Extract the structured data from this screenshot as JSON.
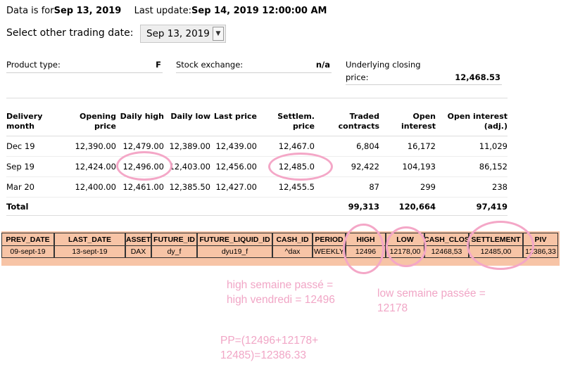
{
  "header": {
    "data_is_for_label": "Data is for",
    "data_date": "Sep 13, 2019",
    "last_update_label": "Last update:",
    "last_update_value": "Sep 14, 2019 12:00:00 AM"
  },
  "date_select": {
    "label": "Select other trading date:",
    "value": "Sep 13, 2019"
  },
  "info": {
    "product_type_label": "Product type:",
    "product_type_value": "F",
    "stock_exchange_label": "Stock exchange:",
    "stock_exchange_value": "n/a",
    "underlying_label_1": "Underlying closing",
    "underlying_label_2": "price:",
    "underlying_value": "12,468.53"
  },
  "table": {
    "headers": [
      [
        "Delivery",
        "month"
      ],
      [
        "Opening",
        "price"
      ],
      [
        "Daily high",
        ""
      ],
      [
        "Daily low",
        ""
      ],
      [
        "Last price",
        ""
      ],
      [
        "Settlem.",
        "price"
      ],
      [
        "Traded",
        "contracts"
      ],
      [
        "Open",
        "interest"
      ],
      [
        "Open interest",
        "(adj.)"
      ]
    ],
    "rows": [
      [
        "Dec 19",
        "12,390.00",
        "12,479.00",
        "12,389.00",
        "12,439.00",
        "12,467.0",
        "6,804",
        "16,172",
        "11,029"
      ],
      [
        "Sep 19",
        "12,424.00",
        "12,496.00",
        "12,403.00",
        "12,456.00",
        "12,485.0",
        "92,422",
        "104,193",
        "86,152"
      ],
      [
        "Mar 20",
        "12,400.00",
        "12,461.00",
        "12,385.50",
        "12,427.00",
        "12,455.5",
        "87",
        "299",
        "238"
      ]
    ],
    "total": {
      "label": "Total",
      "traded": "99,313",
      "open_interest": "120,664",
      "open_interest_adj": "97,419"
    }
  },
  "orange_table": {
    "headers": [
      "PREV_DATE",
      "LAST_DATE",
      "ASSET",
      "FUTURE_ID",
      "FUTURE_LIQUID_ID",
      "CASH_ID",
      "PERIOD",
      "HIGH",
      "LOW",
      "CASH_CLOS",
      "SETTLEMENT",
      "PIV"
    ],
    "row": [
      "09-sept-19",
      "13-sept-19",
      "DAX",
      "dy_f",
      "dyu19_f",
      "^dax",
      "WEEKLY",
      "12496",
      "12178,00",
      "12468,53",
      "12485,00",
      "12386,33"
    ]
  },
  "annotations": {
    "note1_line1": "high semaine passé =",
    "note1_line2": "high vendredi = 12496",
    "note2_line1": "low semaine passée =",
    "note2_line2": "12178",
    "note3_line1": "PP=(12496+12178+",
    "note3_line2": "12485)=12386.33"
  },
  "colors": {
    "annotation_pink": "#f1a6c6",
    "orange_table_bg": "#f7c4a6"
  }
}
